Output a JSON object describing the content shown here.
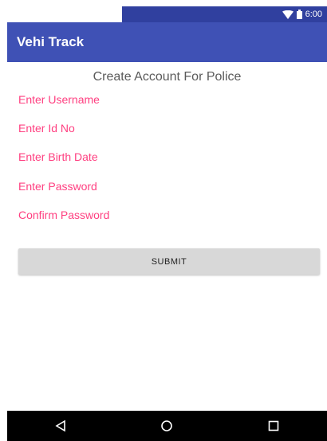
{
  "status_bar": {
    "time": "6:00",
    "icons": [
      "wifi-icon",
      "battery-icon"
    ]
  },
  "app_bar": {
    "title": "Vehi Track",
    "color": "#3f51b5"
  },
  "form": {
    "heading": "Create Account For Police",
    "fields": [
      {
        "placeholder": "Enter Username",
        "value": ""
      },
      {
        "placeholder": "Enter Id No",
        "value": ""
      },
      {
        "placeholder": "Enter Birth Date",
        "value": ""
      },
      {
        "placeholder": "Enter Password",
        "value": ""
      },
      {
        "placeholder": "Confirm Password",
        "value": ""
      }
    ],
    "hint_color": "#ff4081",
    "submit_label": "SUBMIT"
  },
  "nav_bar": {
    "icons": [
      "back-icon",
      "home-icon",
      "recents-icon"
    ]
  }
}
